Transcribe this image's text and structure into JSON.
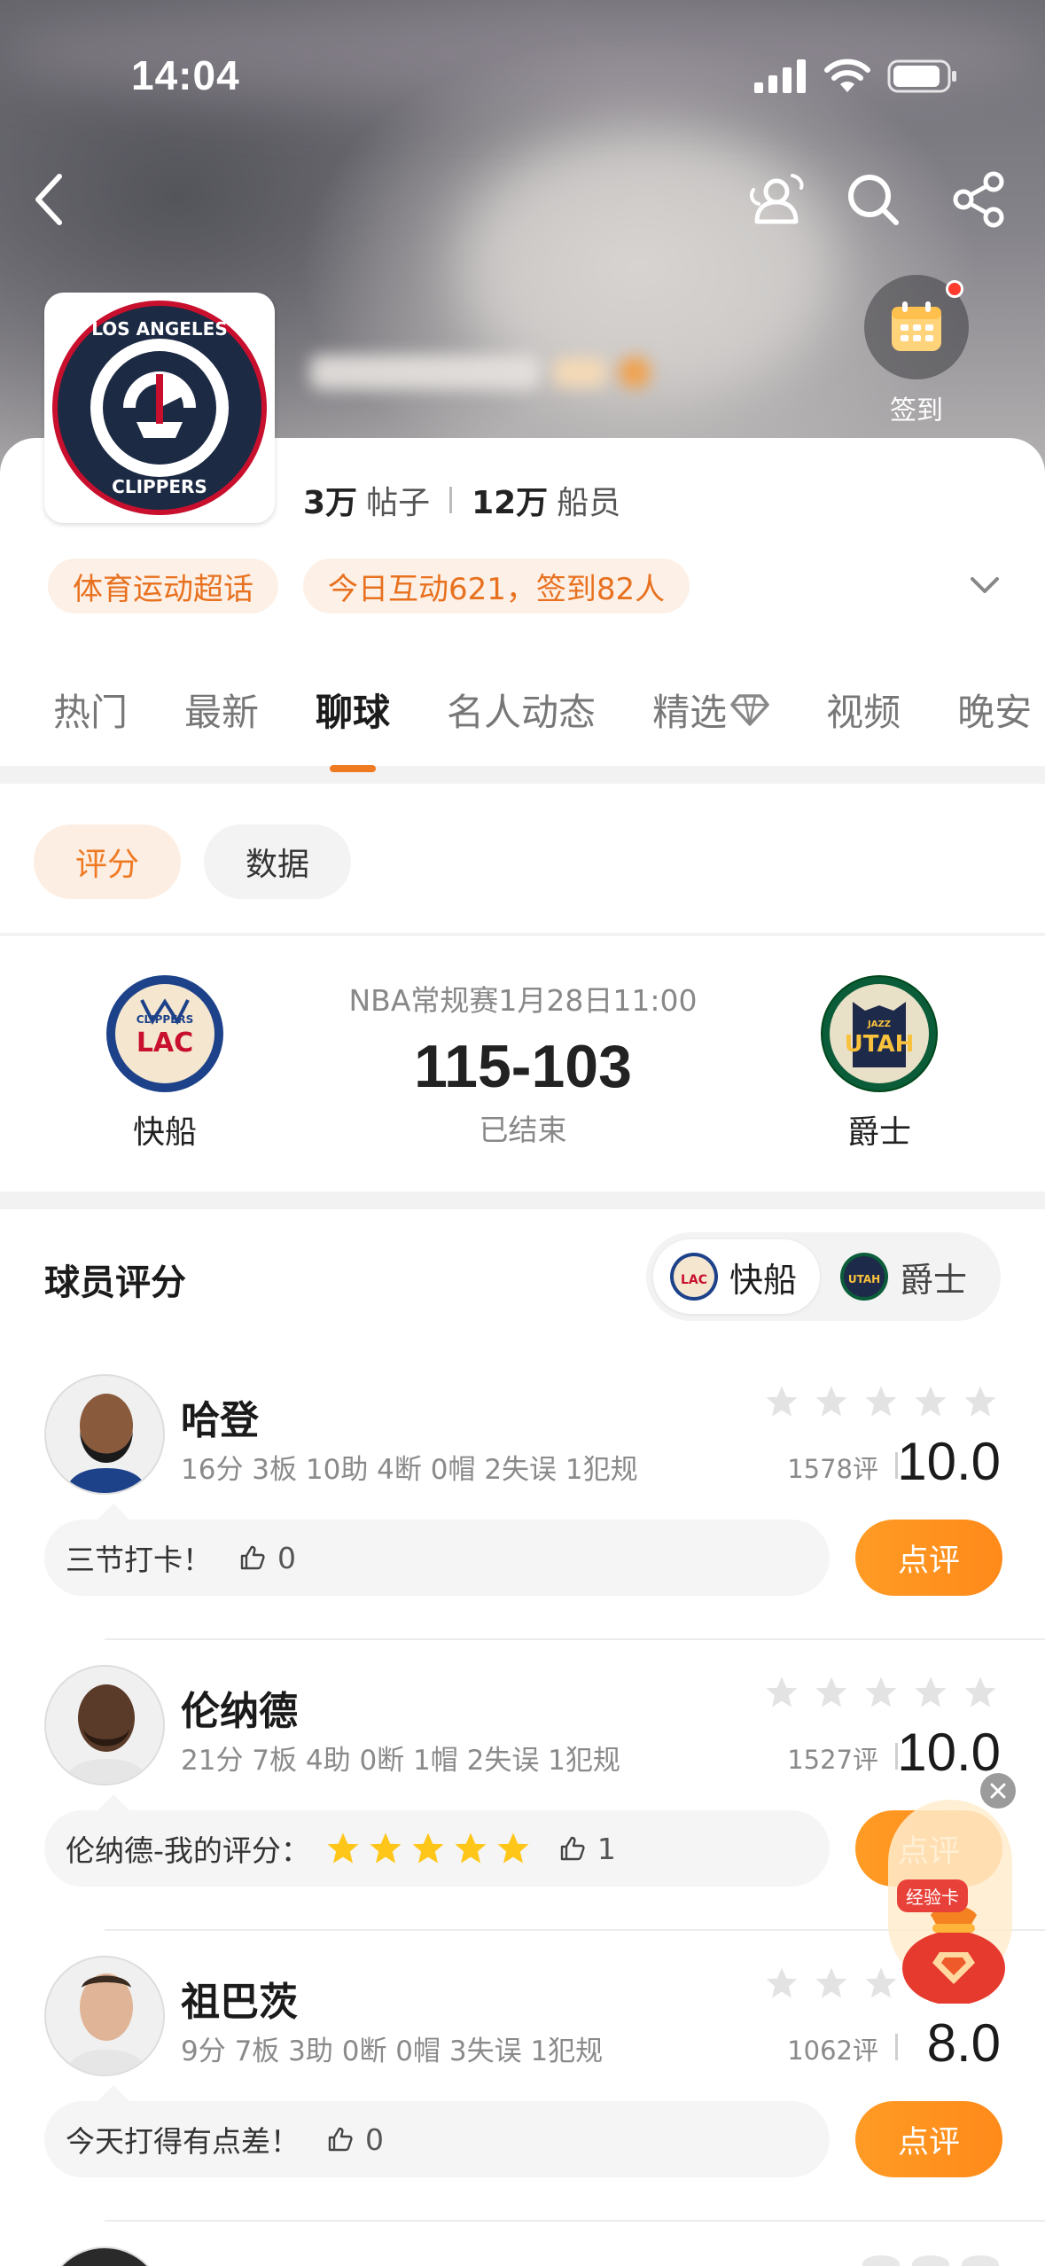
{
  "status": {
    "time": "14:04"
  },
  "header": {
    "checkin_label": "签到",
    "stats": {
      "posts_value": "3万",
      "posts_label": "帖子",
      "members_value": "12万",
      "members_label": "船员"
    },
    "chips": [
      "体育运动超话",
      "今日互动621，签到82人"
    ]
  },
  "tabs": [
    {
      "label": "热门"
    },
    {
      "label": "最新"
    },
    {
      "label": "聊球"
    },
    {
      "label": "名人动态"
    },
    {
      "label": "精选"
    },
    {
      "label": "视频"
    },
    {
      "label": "晚安"
    }
  ],
  "filters": {
    "active": "评分",
    "inactive": "数据"
  },
  "match": {
    "title": "NBA常规赛1月28日11:00",
    "score": "115-103",
    "status": "已结束",
    "home": {
      "name": "快船",
      "abbr": "LAC",
      "sub": "CLIPPERS"
    },
    "away": {
      "name": "爵士",
      "abbr": "UTAH",
      "sub": "JAZZ"
    }
  },
  "players_section": {
    "title": "球员评分",
    "switch": {
      "active": "快船",
      "inactive": "爵士"
    },
    "rate_label": "点评",
    "players": [
      {
        "name": "哈登",
        "stats": "16分 3板 10助 4断 0帽 2失误 1犯规",
        "count": "1578评",
        "score": "10.0",
        "comment": "三节打卡！",
        "rated": false,
        "likes": "0"
      },
      {
        "name": "伦纳德",
        "stats": "21分 7板 4助 0断 1帽 2失误 1犯规",
        "count": "1527评",
        "score": "10.0",
        "comment": "伦纳德-我的评分：",
        "rated": true,
        "likes": "1"
      },
      {
        "name": "祖巴茨",
        "stats": "9分 7板 3助 0断 0帽 3失误 1犯规",
        "count": "1062评",
        "score": "8.0",
        "comment": "今天打得有点差！",
        "rated": false,
        "likes": "0"
      }
    ]
  },
  "float": {
    "tag": "经验卡"
  },
  "colors": {
    "accent": "#f07a22",
    "rate_button": "#ff9b25",
    "chip_bg": "#fdf0e6"
  }
}
